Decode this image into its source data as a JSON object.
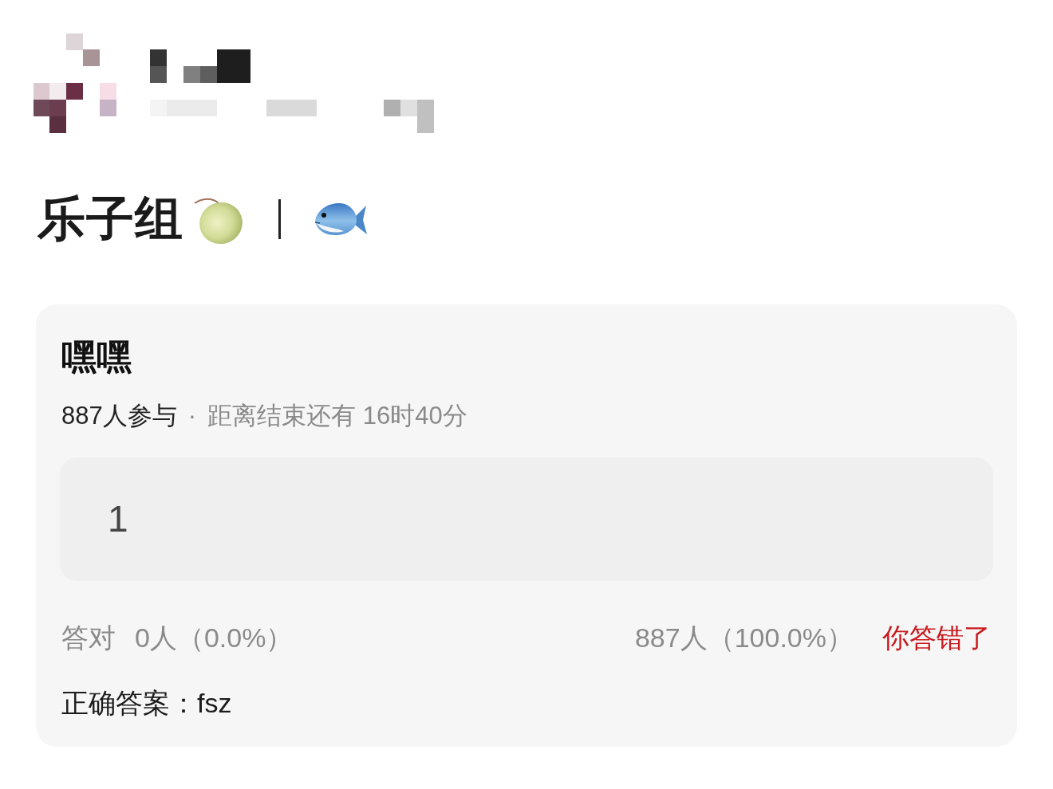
{
  "group": {
    "name": "乐子组"
  },
  "quiz": {
    "title": "嘿嘿",
    "participants": "887人参与",
    "separator": "·",
    "countdown": "距离结束还有 16时40分",
    "answer": "1",
    "results": {
      "correct_label": "答对",
      "correct_count": "0人（0.0%）",
      "wrong_count": "887人（100.0%）",
      "verdict": {
        "text": "你答错了",
        "correct": false
      }
    },
    "correct_answer": "正确答案：fsz"
  }
}
